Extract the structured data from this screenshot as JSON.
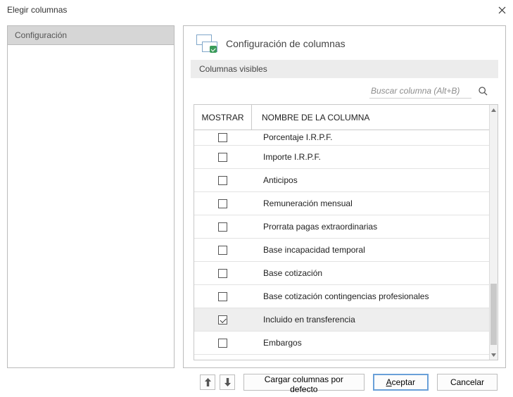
{
  "window": {
    "title": "Elegir columnas"
  },
  "sidebar": {
    "items": [
      {
        "label": "Configuración"
      }
    ]
  },
  "header": {
    "title": "Configuración de columnas"
  },
  "section": {
    "visible_label": "Columnas visibles"
  },
  "search": {
    "placeholder": "Buscar columna (Alt+B)"
  },
  "table": {
    "col_show": "MOSTRAR",
    "col_name": "NOMBRE DE LA COLUMNA",
    "rows": [
      {
        "label": "Porcentaje I.R.P.F.",
        "checked": false,
        "clipped": true
      },
      {
        "label": "Importe I.R.P.F.",
        "checked": false
      },
      {
        "label": "Anticipos",
        "checked": false
      },
      {
        "label": "Remuneración mensual",
        "checked": false
      },
      {
        "label": "Prorrata pagas extraordinarias",
        "checked": false
      },
      {
        "label": "Base incapacidad temporal",
        "checked": false
      },
      {
        "label": "Base cotización",
        "checked": false
      },
      {
        "label": "Base cotización contingencias profesionales",
        "checked": false
      },
      {
        "label": "Incluido en transferencia",
        "checked": true
      },
      {
        "label": "Embargos",
        "checked": false
      }
    ],
    "scroll": {
      "thumb_top_pct": 72,
      "thumb_height_pct": 26
    }
  },
  "footer": {
    "load_defaults": "Cargar columnas por defecto",
    "accept_u": "A",
    "accept_rest": "ceptar",
    "cancel": "Cancelar"
  }
}
